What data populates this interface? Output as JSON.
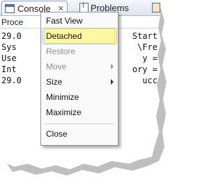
{
  "tabs": [
    {
      "label": "Console",
      "close_glyph": "✕"
    },
    {
      "label": "Problems"
    }
  ],
  "console": {
    "process_label": "Proce",
    "lines": [
      {
        "left": "29.0",
        "right": "Start"
      },
      {
        "left": "Sys",
        "right": "\\Fre"
      },
      {
        "left": "Use",
        "right": "y ="
      },
      {
        "left": "Int",
        "right": "ory ="
      },
      {
        "left": "29.0",
        "right": "ucc"
      }
    ]
  },
  "menu": {
    "items": [
      {
        "label": "Fast View",
        "enabled": true
      },
      {
        "label": "Detached",
        "enabled": true,
        "highlighted": true
      },
      {
        "label": "Restore",
        "enabled": false
      },
      {
        "label": "Move",
        "enabled": false,
        "submenu": true
      },
      {
        "label": "Size",
        "enabled": true,
        "submenu": true
      },
      {
        "label": "Minimize",
        "enabled": true
      },
      {
        "label": "Maximize",
        "enabled": true
      },
      {
        "label": "Close",
        "enabled": true
      }
    ]
  },
  "colors": {
    "highlight": "#fff7a1",
    "highlight_border": "#f0e14a"
  }
}
